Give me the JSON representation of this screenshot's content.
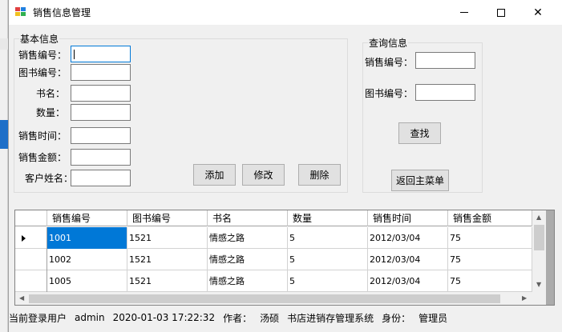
{
  "window": {
    "title": "销售信息管理",
    "minimize_glyph": "",
    "close_glyph": "✕"
  },
  "basic_info": {
    "title": "基本信息",
    "sale_id_label": "销售编号：",
    "book_id_label": "图书编号：",
    "book_name_label": "书名：",
    "quantity_label": "数量：",
    "sale_time_label": "销售时间：",
    "sale_amount_label": "销售金额：",
    "customer_label": "客户姓名：",
    "add_button": "添加",
    "edit_button": "修改",
    "delete_button": "删除"
  },
  "query_info": {
    "title": "查询信息",
    "sale_id_label": "销售编号：",
    "book_id_label": "图书编号：",
    "search_button": "查找",
    "back_button": "返回主菜单"
  },
  "grid": {
    "columns": [
      "销售编号",
      "图书编号",
      "书名",
      "数量",
      "销售时间",
      "销售金额"
    ],
    "rows": [
      [
        "1001",
        "1521",
        "情感之路",
        "5",
        "2012/03/04",
        "75"
      ],
      [
        "1002",
        "1521",
        "情感之路",
        "5",
        "2012/03/04",
        "75"
      ],
      [
        "1005",
        "1521",
        "情感之路",
        "5",
        "2012/03/04",
        "75"
      ]
    ]
  },
  "status": {
    "user_label": "当前登录用户",
    "user": "admin",
    "datetime": "2020-01-03 17:22:32",
    "author_label": "作者：",
    "author": "汤硕",
    "system": "书店进销存管理系统",
    "role_label": "身份：",
    "role": "管理员"
  },
  "colors": {
    "selection": "#0078d7",
    "focus_border": "#0078d7"
  }
}
